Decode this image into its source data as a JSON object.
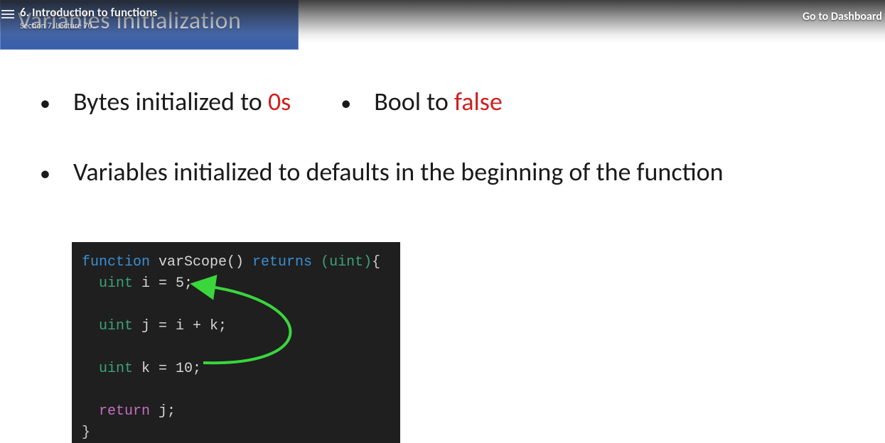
{
  "topbar": {
    "lecture_title": "6. Introduction to functions",
    "lecture_sub": "Section 7, Lecture 70",
    "dashboard": "Go to Dashboard"
  },
  "slide": {
    "title": "Variables Initialization",
    "bullets": {
      "b1_prefix": "Bytes initialized to ",
      "b1_hl": "0s",
      "b2_prefix": "Bool to ",
      "b2_hl": "false",
      "b3": "Variables initialized to defaults in the beginning of the function"
    }
  },
  "code": {
    "l1_kw": "function",
    "l1_fn": " varScope() ",
    "l1_ret": "returns",
    "l1_typ": " (uint)",
    "l1_br": "{",
    "l2_ind": "  ",
    "l2_typ": "uint",
    "l2_rest": " i = 5;",
    "l3_ind": "  ",
    "l3_typ": "uint",
    "l3_rest": " j = i + k;",
    "l4_ind": "  ",
    "l4_typ": "uint",
    "l4_rest": " k = 10;",
    "l5_ind": "  ",
    "l5_ret": "return",
    "l5_rest": " j;",
    "l6": "}"
  }
}
